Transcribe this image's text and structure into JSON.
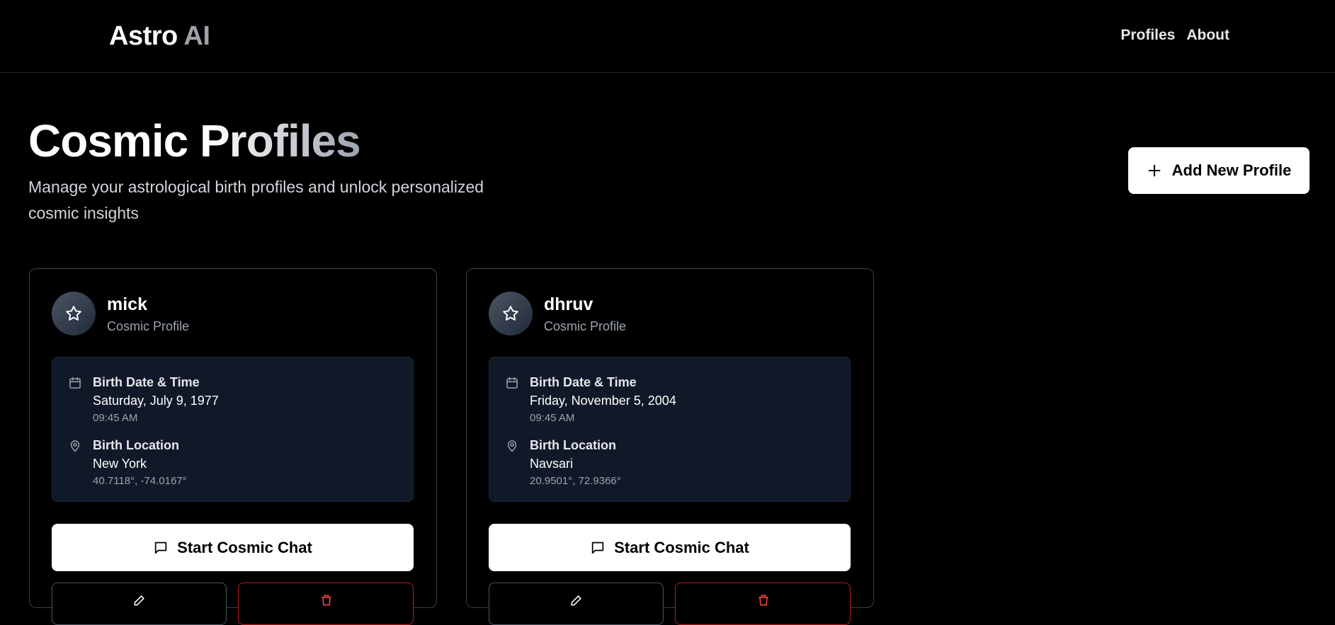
{
  "header": {
    "brand_part1": "Astro",
    "brand_part2": "AI",
    "nav": {
      "profiles": "Profiles",
      "about": "About"
    }
  },
  "hero": {
    "title": "Cosmic Profiles",
    "subtitle": "Manage your astrological birth profiles and unlock personalized cosmic insights",
    "add_button": "Add New Profile"
  },
  "profiles": [
    {
      "name": "mick",
      "subtitle": "Cosmic Profile",
      "birth_label": "Birth Date & Time",
      "birth_date": "Saturday, July 9, 1977",
      "birth_time": "09:45 AM",
      "location_label": "Birth Location",
      "location": "New York",
      "coords": "40.7118°, -74.0167°",
      "chat_button": "Start Cosmic Chat"
    },
    {
      "name": "dhruv",
      "subtitle": "Cosmic Profile",
      "birth_label": "Birth Date & Time",
      "birth_date": "Friday, November 5, 2004",
      "birth_time": "09:45 AM",
      "location_label": "Birth Location",
      "location": "Navsari",
      "coords": "20.9501°, 72.9366°",
      "chat_button": "Start Cosmic Chat"
    }
  ],
  "icons": {
    "avatar": "star-icon",
    "birth": "calendar-icon",
    "location": "map-pin-icon",
    "chat": "message-square-icon",
    "add": "plus-icon",
    "edit": "pencil-icon",
    "delete": "trash-icon"
  },
  "colors": {
    "background": "#000000",
    "info_panel": "#111827",
    "delete_border": "#b91c1c",
    "edit_border": "#4b5563"
  }
}
